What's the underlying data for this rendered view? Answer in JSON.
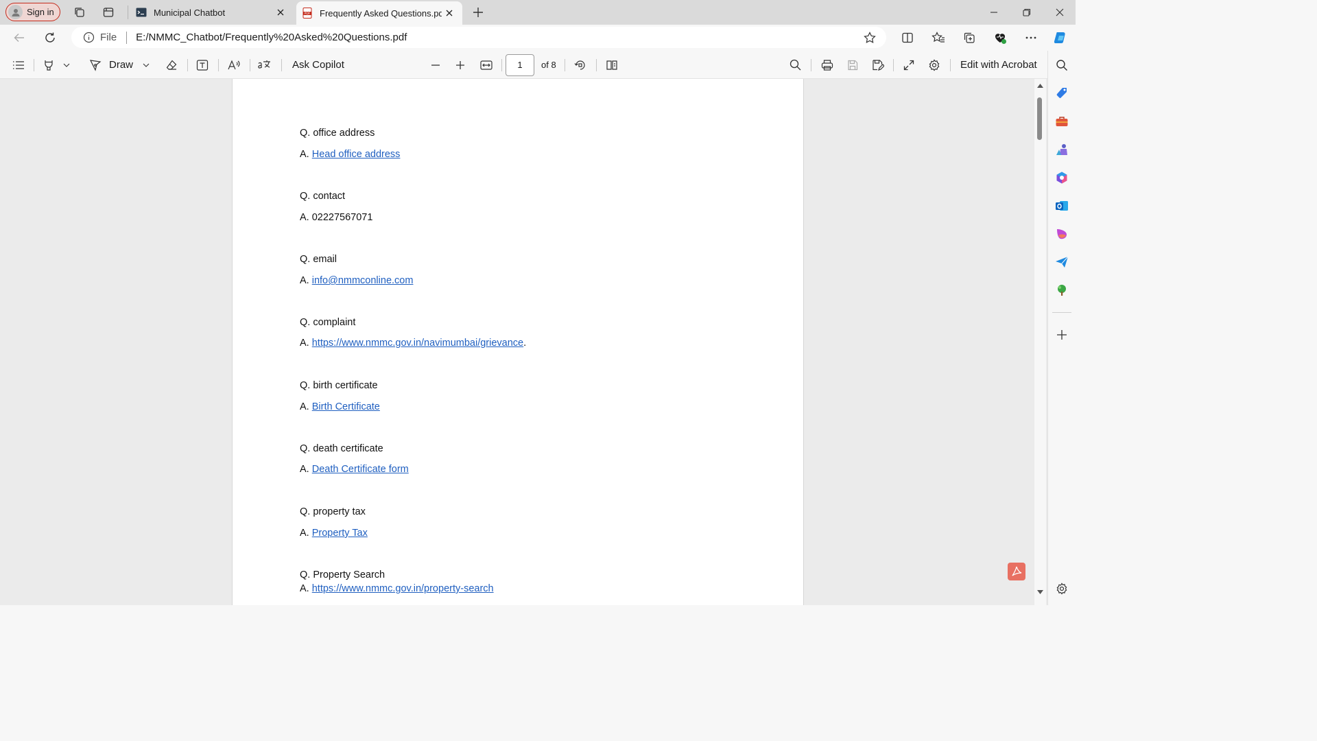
{
  "titlebar": {
    "signin_label": "Sign in",
    "tabs": [
      {
        "label": "Municipal Chatbot",
        "icon": "terminal-icon"
      },
      {
        "label": "Frequently Asked Questions.pdf",
        "icon": "pdf-icon"
      }
    ]
  },
  "addressbar": {
    "scheme_label": "File",
    "url": "E:/NMMC_Chatbot/Frequently%20Asked%20Questions.pdf"
  },
  "pdf_toolbar": {
    "draw_label": "Draw",
    "ask_copilot_label": "Ask Copilot",
    "page_current": "1",
    "page_total_label": "of 8",
    "edit_label": "Edit with Acrobat"
  },
  "document": {
    "items": [
      {
        "q": "Q. office address",
        "a_prefix": "A. ",
        "a_link": "Head office address",
        "a_suffix": ""
      },
      {
        "q": "Q. contact",
        "a_prefix": "A. 02227567071",
        "a_link": "",
        "a_suffix": ""
      },
      {
        "q": "Q. email",
        "a_prefix": "A. ",
        "a_link": "info@nmmconline.com",
        "a_suffix": ""
      },
      {
        "q": "Q. complaint",
        "a_prefix": "A. ",
        "a_link": "https://www.nmmc.gov.in/navimumbai/grievance",
        "a_suffix": "."
      },
      {
        "q": "Q. birth certificate",
        "a_prefix": "A. ",
        "a_link": "Birth Certificate",
        "a_suffix": ""
      },
      {
        "q": "Q. death certificate",
        "a_prefix": "A. ",
        "a_link": "Death Certificate form",
        "a_suffix": ""
      },
      {
        "q": "Q. property tax",
        "a_prefix": "A. ",
        "a_link": "Property Tax",
        "a_suffix": ""
      },
      {
        "q": "Q. Property Search",
        "a_prefix": "A. ",
        "a_link": "https://www.nmmc.gov.in/property-search",
        "a_suffix": ""
      }
    ]
  },
  "colors": {
    "link": "#1f5fc0",
    "signin_border": "#c42b1c",
    "copilot_accent": "#1f8ae0"
  }
}
